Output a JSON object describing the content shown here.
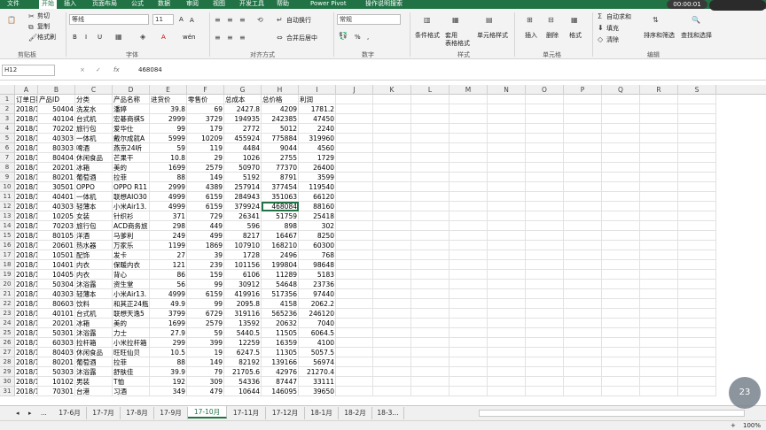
{
  "ribbon_tabs": [
    "文件",
    "开始",
    "插入",
    "页面布局",
    "公式",
    "数据",
    "审阅",
    "视图",
    "开发工具",
    "帮助",
    "Power Pivot",
    "操作说明搜索"
  ],
  "clipboard": {
    "cut": "剪切",
    "copy": "复制",
    "format_painter": "格式刷",
    "group": "剪贴板"
  },
  "font": {
    "name": "等线",
    "size": "11",
    "grow": "A",
    "shrink": "A",
    "bold": "B",
    "italic": "I",
    "underline": "U",
    "wen": "wén",
    "group": "字体"
  },
  "alignment": {
    "wrap": "自动换行",
    "merge": "合并后居中",
    "group": "对齐方式"
  },
  "number": {
    "format": "常规",
    "percent": "%",
    "comma": ",",
    "group": "数字"
  },
  "styles": {
    "conditional": "条件格式",
    "table": "套用\n表格格式",
    "cell_styles": "单元格样式",
    "group": "样式"
  },
  "cells": {
    "insert": "插入",
    "delete": "删除",
    "format": "格式",
    "group": "单元格"
  },
  "editing": {
    "autosum": "自动求和",
    "fill": "填充",
    "clear": "清除",
    "sort_filter": "排序和筛选",
    "find_select": "查找和选择",
    "group": "编辑"
  },
  "formula_bar": {
    "name_box": "H12",
    "cancel": "×",
    "enter": "✓",
    "fx": "fx",
    "value": "468084"
  },
  "columns": [
    "A",
    "B",
    "C",
    "D",
    "E",
    "F",
    "G",
    "H",
    "I",
    "J",
    "K",
    "L",
    "M",
    "N",
    "O",
    "P",
    "Q",
    "R",
    "S"
  ],
  "rows": [
    [
      "订单日期",
      "产品ID",
      "分类",
      "产品名称",
      "进货价",
      "零售价",
      "总成本",
      "总价格",
      "利润"
    ],
    [
      "2018/10/1",
      "50404",
      "洗发水",
      "潘婷",
      "39.8",
      "69",
      "2427.8",
      "4209",
      "1781.2"
    ],
    [
      "2018/10/1",
      "40104",
      "台式机",
      "宏碁商祺S",
      "2999",
      "3729",
      "194935",
      "242385",
      "47450"
    ],
    [
      "2018/10/1",
      "70202",
      "旅行包",
      "爱华仕",
      "99",
      "179",
      "2772",
      "5012",
      "2240"
    ],
    [
      "2018/10/1",
      "40303",
      "一体机",
      "戴尔成就A",
      "5999",
      "10209",
      "455924",
      "775884",
      "319960"
    ],
    [
      "2018/10/1",
      "80303",
      "啤酒",
      "燕京24听",
      "59",
      "119",
      "4484",
      "9044",
      "4560"
    ],
    [
      "2018/10/1",
      "80404",
      "休闲食品",
      "芒果干",
      "10.8",
      "29",
      "1026",
      "2755",
      "1729"
    ],
    [
      "2018/10/1",
      "20201",
      "冰箱",
      "美的",
      "1699",
      "2579",
      "50970",
      "77370",
      "26400"
    ],
    [
      "2018/10/1",
      "80201",
      "葡萄酒",
      "拉菲",
      "88",
      "149",
      "5192",
      "8791",
      "3599"
    ],
    [
      "2018/10/1",
      "30501",
      "OPPO",
      "OPPO R11",
      "2999",
      "4389",
      "257914",
      "377454",
      "119540"
    ],
    [
      "2018/10/1",
      "40401",
      "一体机",
      "联想AIO30",
      "4999",
      "6159",
      "284943",
      "351063",
      "66120"
    ],
    [
      "2018/10/1",
      "40303",
      "轻薄本",
      "小米Air13.",
      "4999",
      "6159",
      "379924",
      "468084",
      "88160"
    ],
    [
      "2018/10/1",
      "10205",
      "女装",
      "针织衫",
      "371",
      "729",
      "26341",
      "51759",
      "25418"
    ],
    [
      "2018/10/1",
      "70203",
      "旅行包",
      "ACD商务旅",
      "298",
      "449",
      "596",
      "898",
      "302"
    ],
    [
      "2018/10/1",
      "80105",
      "洋酒",
      "马爹利",
      "249",
      "499",
      "8217",
      "16467",
      "8250"
    ],
    [
      "2018/10/1",
      "20601",
      "热水器",
      "万家乐",
      "1199",
      "1869",
      "107910",
      "168210",
      "60300"
    ],
    [
      "2018/10/2",
      "10501",
      "配饰",
      "发卡",
      "27",
      "39",
      "1728",
      "2496",
      "768"
    ],
    [
      "2018/10/2",
      "10401",
      "内衣",
      "保暖内衣",
      "121",
      "239",
      "101156",
      "199804",
      "98648"
    ],
    [
      "2018/10/2",
      "10405",
      "内衣",
      "背心",
      "86",
      "159",
      "6106",
      "11289",
      "5183"
    ],
    [
      "2018/10/2",
      "50304",
      "沐浴露",
      "资生堂",
      "56",
      "99",
      "30912",
      "54648",
      "23736"
    ],
    [
      "2018/10/2",
      "40303",
      "轻薄本",
      "小米Air13.",
      "4999",
      "6159",
      "419916",
      "517356",
      "97440"
    ],
    [
      "2018/10/2",
      "80603",
      "饮料",
      "和其正24瓶",
      "49.9",
      "99",
      "2095.8",
      "4158",
      "2062.2"
    ],
    [
      "2018/10/2",
      "40101",
      "台式机",
      "联想天逸5",
      "3799",
      "6729",
      "319116",
      "565236",
      "246120"
    ],
    [
      "2018/10/2",
      "20201",
      "冰箱",
      "美的",
      "1699",
      "2579",
      "13592",
      "20632",
      "7040"
    ],
    [
      "2018/10/3",
      "50301",
      "沐浴露",
      "力士",
      "27.9",
      "59",
      "5440.5",
      "11505",
      "6064.5"
    ],
    [
      "2018/10/3",
      "60303",
      "拉杆箱",
      "小米拉杆箱",
      "299",
      "399",
      "12259",
      "16359",
      "4100"
    ],
    [
      "2018/10/3",
      "80403",
      "休闲食品",
      "旺旺仙贝",
      "10.5",
      "19",
      "6247.5",
      "11305",
      "5057.5"
    ],
    [
      "2018/10/3",
      "80201",
      "葡萄酒",
      "拉菲",
      "88",
      "149",
      "82192",
      "139166",
      "56974"
    ],
    [
      "2018/10/3",
      "50303",
      "沐浴露",
      "舒肤佳",
      "39.9",
      "79",
      "21705.6",
      "42976",
      "21270.4"
    ],
    [
      "2018/10/3",
      "10102",
      "男装",
      "T恤",
      "192",
      "309",
      "54336",
      "87447",
      "33111"
    ],
    [
      "2018/10/3",
      "70301",
      "台港",
      "习酒",
      "349",
      "479",
      "10644",
      "146095",
      "39650"
    ]
  ],
  "numeric_cols": [
    1,
    4,
    5,
    6,
    7,
    8
  ],
  "sheet_tabs": [
    "17-6月",
    "17-7月",
    "17-8月",
    "17-9月",
    "17-10月",
    "17-11月",
    "17-12月",
    "18-1月",
    "18-2月",
    "18-3..."
  ],
  "active_sheet": "17-10月",
  "status": {
    "zoom": "100%",
    "plus": "+"
  },
  "overlay": {
    "time": "00:00:01",
    "badge": "23"
  },
  "colors": {
    "accent": "#217346",
    "header_bg": "#f0f0f0"
  }
}
